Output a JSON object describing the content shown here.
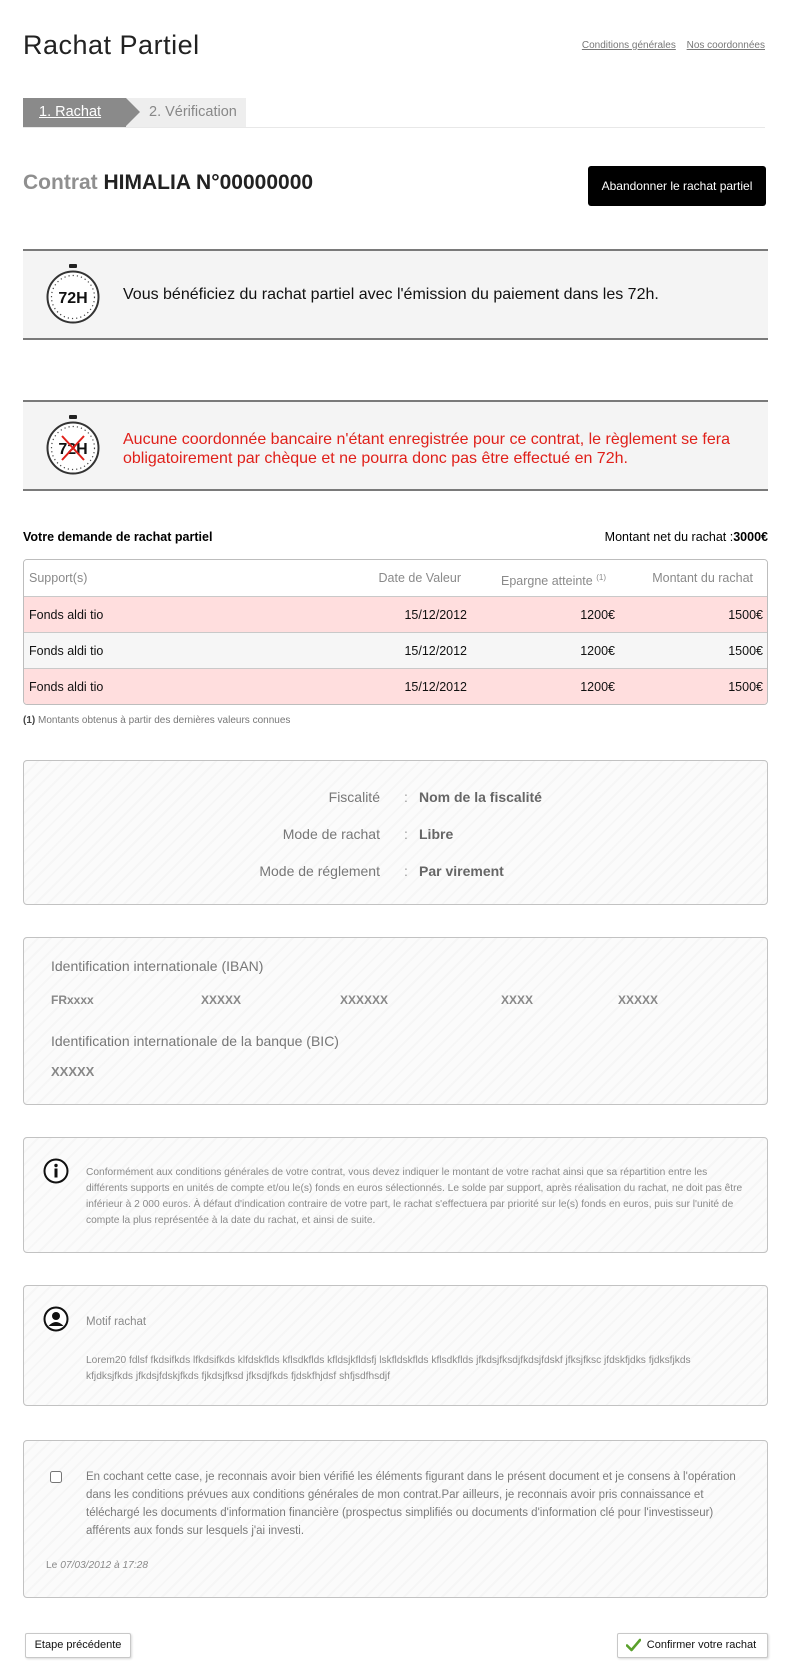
{
  "header": {
    "title": "Rachat Partiel",
    "links": [
      "Conditions générales",
      "Nos coordonnées"
    ]
  },
  "steps": [
    "1. Rachat",
    "2. Vérification"
  ],
  "contract": {
    "label": "Contrat",
    "name": "HIMALIA N°00000000",
    "abandon_button": "Abandonner le rachat partiel"
  },
  "notices": {
    "fast_payment": {
      "icon": "stopwatch-72h-icon",
      "icon_text": "72H",
      "message": "Vous bénéficiez du rachat partiel avec l'émission du paiement dans les 72h."
    },
    "no_bank": {
      "icon": "stopwatch-72h-crossed-icon",
      "icon_text": "72H",
      "message": "Aucune coordonnée bancaire n'étant enregistrée pour ce contrat, le règlement se fera obligatoirement par chèque et ne pourra donc pas être effectué en 72h.",
      "color": "#e0201a"
    }
  },
  "demand": {
    "title": "Votre demande de rachat partiel",
    "net_amount_label": "Montant net du rachat :",
    "net_amount_value": "3000€"
  },
  "table": {
    "columns": [
      "Support(s)",
      "Date de Valeur",
      "Epargne atteinte",
      "Montant du rachat"
    ],
    "epargne_note": "(1)",
    "rows": [
      {
        "support": "Fonds aldi tio",
        "date": "15/12/2012",
        "epargne": "1200€",
        "montant": "1500€"
      },
      {
        "support": "Fonds aldi tio",
        "date": "15/12/2012",
        "epargne": "1200€",
        "montant": "1500€"
      },
      {
        "support": "Fonds aldi tio",
        "date": "15/12/2012",
        "epargne": "1200€",
        "montant": "1500€"
      }
    ],
    "row_colors": [
      "#ffdede",
      "#f6f6f6",
      "#ffdede"
    ]
  },
  "footnote": {
    "marker": "(1)",
    "text": "Montants obtenus à partir des dernières valeurs connues"
  },
  "fiscal": {
    "items": [
      {
        "label": "Fiscalité",
        "value": "Nom de la fiscalité"
      },
      {
        "label": "Mode de rachat",
        "value": "Libre"
      },
      {
        "label": "Mode de réglement",
        "value": "Par virement"
      }
    ],
    "separator": ":"
  },
  "bank": {
    "iban_label": "Identification internationale (IBAN)",
    "iban_parts": [
      "FRxxxx",
      "XXXXX",
      "XXXXXX",
      "XXXX",
      "XXXXX"
    ],
    "bic_label": "Identification internationale de la banque (BIC)",
    "bic_value": "XXXXX"
  },
  "info": {
    "icon": "info-icon",
    "text": "Conformément aux conditions générales de votre contrat, vous devez indiquer le montant de votre rachat ainsi que sa répartition entre les différents supports en unités de compte et/ou le(s) fonds en euros sélectionnés. Le solde par support, après réalisation du rachat, ne doit pas être inférieur à 2 000 euros. À défaut d'indication contraire de votre part, le rachat s'effectuera par priorité sur le(s) fonds en euros, puis sur l'unité de compte la plus représentée à la date du rachat, et ainsi de suite."
  },
  "motif": {
    "icon": "user-icon",
    "title": "Motif rachat",
    "text": "Lorem20 fdlsf fkdsifkds lfkdsifkds klfdskflds kflsdkflds kfldsjkfldsfj lskfldskflds kflsdkflds jfkdsjfksdjfkdsjfdskf jfksjfksc jfdskfjdks fjdksfjkds kfjdksjfkds jfkdsjfdskjfkds fjkdsjfksd jfksdjfkds fjdskfhjdsf shfjsdfhsdjf"
  },
  "consent": {
    "checked": false,
    "text": "En cochant cette case, je reconnais avoir bien vérifié les éléments figurant dans le présent document et je consens à l'opération dans les conditions prévues aux conditions générales de mon contrat.Par ailleurs, je reconnais avoir pris connaissance et téléchargé les documents d'information financière (prospectus simplifiés ou documents d'information clé pour l'investisseur) afférents aux fonds sur lesquels j'ai investi.",
    "date_prefix": "Le",
    "date_value": "07/03/2012 à 17:28"
  },
  "actions": {
    "previous": "Etape précédente",
    "confirm": "Confirmer votre rachat",
    "confirm_icon": "checkmark-icon",
    "confirm_icon_color": "#5aa02c"
  }
}
